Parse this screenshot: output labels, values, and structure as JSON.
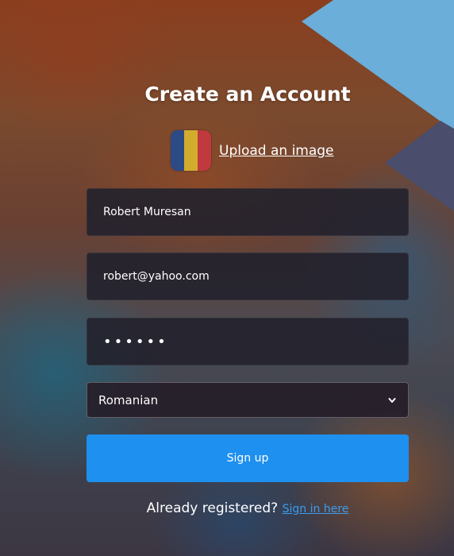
{
  "header": {
    "title": "Create an Account"
  },
  "avatar": {
    "flag_colors": [
      "#2c4a86",
      "#d2ad2d",
      "#c0393f"
    ],
    "upload_label": "Upload an image"
  },
  "form": {
    "name_value": "Robert Muresan",
    "email_value": "robert@yahoo.com",
    "password_value": "••••••",
    "language_selected": "Romanian",
    "submit_label": "Sign up"
  },
  "footer": {
    "prompt": "Already registered?",
    "link_label": "Sign in here"
  },
  "colors": {
    "accent": "#1e90f0",
    "link": "#3b9cf0",
    "triangle_light": "#6aaed9",
    "triangle_dark": "#4a4d6b"
  }
}
